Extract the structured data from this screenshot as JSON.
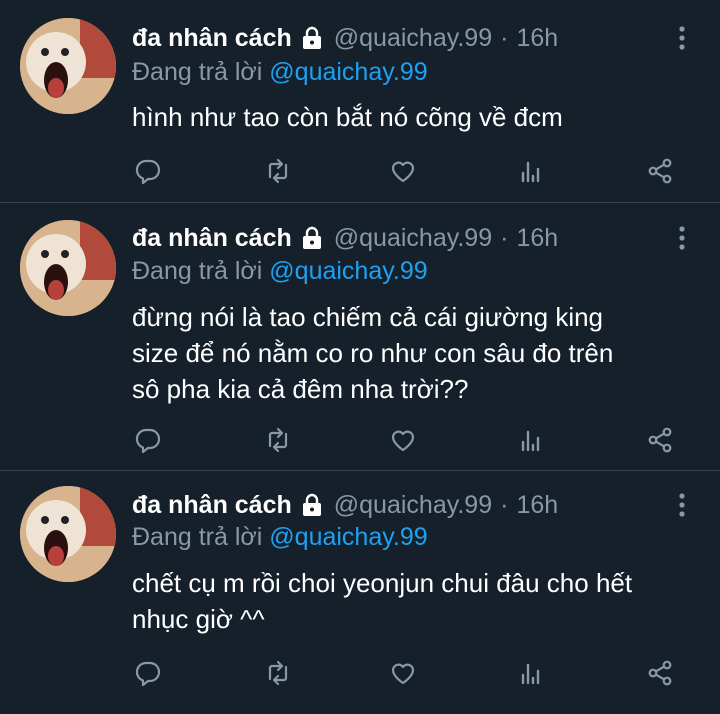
{
  "colors": {
    "background": "#15202b",
    "name": "#ffffff",
    "meta": "#8899a6",
    "mention": "#1da1f2",
    "divider": "#38444d"
  },
  "tweets": [
    {
      "display_name": "đa nhân cách",
      "handle": "@quaichay.99",
      "separator": "·",
      "time": "16h",
      "reply_prefix": "Đang trả lời ",
      "reply_to": "@quaichay.99",
      "text_lines": [
        "hình như tao còn bắt nó cõng về đcm"
      ]
    },
    {
      "display_name": "đa nhân cách",
      "handle": "@quaichay.99",
      "separator": "·",
      "time": "16h",
      "reply_prefix": "Đang trả lời ",
      "reply_to": "@quaichay.99",
      "text_lines": [
        "đừng nói là tao chiếm cả cái giường king",
        "size để nó nằm co ro như con sâu đo trên",
        "sô pha kia cả đêm nha trời??"
      ]
    },
    {
      "display_name": "đa nhân cách",
      "handle": "@quaichay.99",
      "separator": "·",
      "time": "16h",
      "reply_prefix": "Đang trả lời ",
      "reply_to": "@quaichay.99",
      "text_lines": [
        "chết cụ m rồi choi yeonjun chui đâu cho hết",
        "nhục giờ ^^"
      ]
    }
  ],
  "icons": {
    "lock": "lock-icon",
    "more": "more-vertical-icon",
    "reply": "reply-icon",
    "retweet": "retweet-icon",
    "like": "heart-icon",
    "analytics": "analytics-icon",
    "share": "share-icon"
  }
}
